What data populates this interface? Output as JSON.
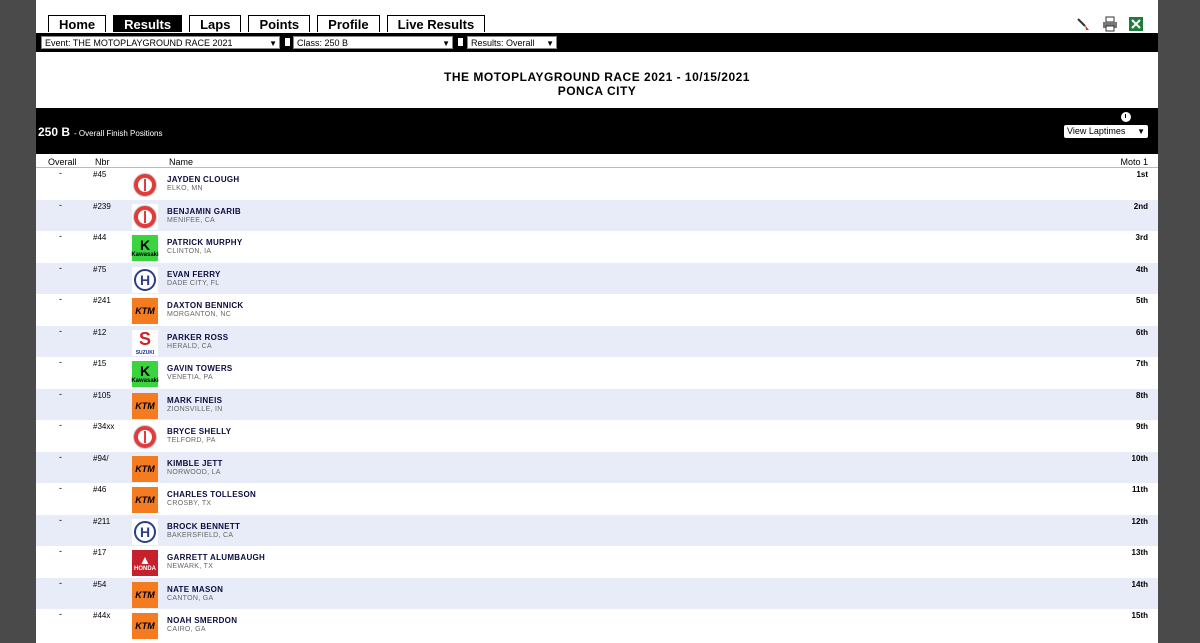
{
  "nav": {
    "tabs": [
      {
        "label": "Home",
        "active": false
      },
      {
        "label": "Results",
        "active": true
      },
      {
        "label": "Laps",
        "active": false
      },
      {
        "label": "Points",
        "active": false
      },
      {
        "label": "Profile",
        "active": false
      },
      {
        "label": "Live Results",
        "active": false
      }
    ],
    "icons": [
      "brush-icon",
      "print-icon",
      "excel-icon"
    ]
  },
  "filters": {
    "event": "Event: THE MOTOPLAYGROUND RACE 2021",
    "class": "Class: 250 B",
    "results": "Results: Overall"
  },
  "header": {
    "title": "THE MOTOPLAYGROUND RACE 2021 - 10/15/2021",
    "location": "PONCA CITY"
  },
  "class_bar": {
    "name": "250 B",
    "subtitle": "- Overall Finish Positions",
    "laptimes_select": "View Laptimes"
  },
  "table": {
    "headers": {
      "overall": "Overall",
      "nbr": "Nbr",
      "name": "Name",
      "moto": "Moto 1"
    },
    "rows": [
      {
        "overall": "-",
        "nbr": "#45",
        "brand": "yamaha",
        "name": "JAYDEN CLOUGH",
        "location": "ELKO, MN",
        "moto1": "1st"
      },
      {
        "overall": "-",
        "nbr": "#239",
        "brand": "yamaha",
        "name": "BENJAMIN GARIB",
        "location": "MENIFEE, CA",
        "moto1": "2nd"
      },
      {
        "overall": "-",
        "nbr": "#44",
        "brand": "kawasaki",
        "name": "PATRICK MURPHY",
        "location": "CLINTON, IA",
        "moto1": "3rd"
      },
      {
        "overall": "-",
        "nbr": "#75",
        "brand": "husqvarna",
        "name": "EVAN FERRY",
        "location": "DADE CITY, FL",
        "moto1": "4th"
      },
      {
        "overall": "-",
        "nbr": "#241",
        "brand": "ktm",
        "name": "DAXTON BENNICK",
        "location": "MORGANTON, NC",
        "moto1": "5th"
      },
      {
        "overall": "-",
        "nbr": "#12",
        "brand": "suzuki",
        "name": "PARKER ROSS",
        "location": "HERALD, CA",
        "moto1": "6th"
      },
      {
        "overall": "-",
        "nbr": "#15",
        "brand": "kawasaki",
        "name": "GAVIN TOWERS",
        "location": "VENETIA, PA",
        "moto1": "7th"
      },
      {
        "overall": "-",
        "nbr": "#105",
        "brand": "ktm",
        "name": "MARK FINEIS",
        "location": "ZIONSVILLE, IN",
        "moto1": "8th"
      },
      {
        "overall": "-",
        "nbr": "#34xx",
        "brand": "yamaha",
        "name": "BRYCE SHELLY",
        "location": "TELFORD, PA",
        "moto1": "9th"
      },
      {
        "overall": "-",
        "nbr": "#94/",
        "brand": "ktm",
        "name": "KIMBLE JETT",
        "location": "NORWOOD, LA",
        "moto1": "10th"
      },
      {
        "overall": "-",
        "nbr": "#46",
        "brand": "ktm",
        "name": "CHARLES TOLLESON",
        "location": "CROSBY, TX",
        "moto1": "11th"
      },
      {
        "overall": "-",
        "nbr": "#211",
        "brand": "husqvarna",
        "name": "BROCK BENNETT",
        "location": "BAKERSFIELD, CA",
        "moto1": "12th"
      },
      {
        "overall": "-",
        "nbr": "#17",
        "brand": "honda",
        "name": "GARRETT ALUMBAUGH",
        "location": "NEWARK, TX",
        "moto1": "13th"
      },
      {
        "overall": "-",
        "nbr": "#54",
        "brand": "ktm",
        "name": "NATE MASON",
        "location": "CANTON, GA",
        "moto1": "14th"
      },
      {
        "overall": "-",
        "nbr": "#44x",
        "brand": "ktm",
        "name": "NOAH SMERDON",
        "location": "CAIRO, GA",
        "moto1": "15th"
      }
    ]
  },
  "brand_logos": {
    "kawasaki": {
      "glyph": "K",
      "caption": "Kawasaki"
    },
    "husqvarna": {
      "glyph": "H"
    },
    "ktm": {
      "glyph": "KTM"
    },
    "suzuki": {
      "glyph": "S",
      "caption": "SUZUKI"
    },
    "honda": {
      "glyph": "▲",
      "caption": "HONDA"
    }
  },
  "colors": {
    "ktm": "#f47b20",
    "kawasaki": "#39d43e",
    "yamaha": "#e23b3b",
    "honda": "#c5202c",
    "husqvarna": "#2a3f87",
    "row_alt": "#e8ecf8"
  }
}
